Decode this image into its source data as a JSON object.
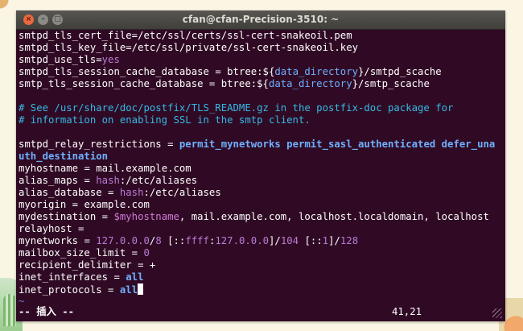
{
  "window": {
    "title": "cfan@cfan-Precision-3510: ~"
  },
  "controls": {
    "close": "×",
    "minimize": "–",
    "maximize": "□"
  },
  "editor": {
    "lines": [
      [
        {
          "t": "smtpd_tls_cert_file",
          "c": "k"
        },
        {
          "t": "=/etc/ssl/certs/ssl-cert-snakeoil.pem",
          "c": "v"
        }
      ],
      [
        {
          "t": "smtpd_tls_key_file",
          "c": "k"
        },
        {
          "t": "=/etc/ssl/private/ssl-cert-snakeoil.key",
          "c": "v"
        }
      ],
      [
        {
          "t": "smtpd_use_tls",
          "c": "k"
        },
        {
          "t": "=",
          "c": "v"
        },
        {
          "t": "yes",
          "c": "pu"
        }
      ],
      [
        {
          "t": "smtpd_tls_session_cache_database",
          "c": "k"
        },
        {
          "t": " = btree:${",
          "c": "v"
        },
        {
          "t": "data_directory",
          "c": "bl"
        },
        {
          "t": "}/smtpd_scache",
          "c": "v"
        }
      ],
      [
        {
          "t": "smtp_tls_session_cache_database",
          "c": "k"
        },
        {
          "t": " = btree:${",
          "c": "v"
        },
        {
          "t": "data_directory",
          "c": "bl"
        },
        {
          "t": "}/smtp_scache",
          "c": "v"
        }
      ],
      [],
      [
        {
          "t": "# See /usr/share/doc/postfix/TLS_README.gz in the postfix-doc package for",
          "c": "cm"
        }
      ],
      [
        {
          "t": "# information on enabling SSL in the smtp client.",
          "c": "cm"
        }
      ],
      [],
      [
        {
          "t": "smtpd_relay_restrictions",
          "c": "k"
        },
        {
          "t": " = ",
          "c": "v"
        },
        {
          "t": "permit_mynetworks permit_sasl_authenticated defer_una",
          "c": "bb"
        }
      ],
      [
        {
          "t": "uth_destination",
          "c": "bb"
        }
      ],
      [
        {
          "t": "myhostname",
          "c": "k"
        },
        {
          "t": " = mail.example.com",
          "c": "v"
        }
      ],
      [
        {
          "t": "alias_maps",
          "c": "k"
        },
        {
          "t": " = ",
          "c": "v"
        },
        {
          "t": "hash",
          "c": "pu"
        },
        {
          "t": ":/etc/aliases",
          "c": "v"
        }
      ],
      [
        {
          "t": "alias_database",
          "c": "k"
        },
        {
          "t": " = ",
          "c": "v"
        },
        {
          "t": "hash",
          "c": "pu"
        },
        {
          "t": ":/etc/aliases",
          "c": "v"
        }
      ],
      [
        {
          "t": "myorigin",
          "c": "k"
        },
        {
          "t": " = example.com",
          "c": "v"
        }
      ],
      [
        {
          "t": "mydestination",
          "c": "k"
        },
        {
          "t": " = ",
          "c": "v"
        },
        {
          "t": "$myhostname",
          "c": "mg"
        },
        {
          "t": ", mail.example.com, localhost.localdomain, localhost",
          "c": "v"
        }
      ],
      [
        {
          "t": "relayhost",
          "c": "k"
        },
        {
          "t": " =",
          "c": "v"
        }
      ],
      [
        {
          "t": "mynetworks",
          "c": "k"
        },
        {
          "t": " = ",
          "c": "v"
        },
        {
          "t": "127.0.0.0",
          "c": "pu"
        },
        {
          "t": "/",
          "c": "v"
        },
        {
          "t": "8",
          "c": "pu"
        },
        {
          "t": " [::",
          "c": "v"
        },
        {
          "t": "ffff",
          "c": "pu"
        },
        {
          "t": ":",
          "c": "v"
        },
        {
          "t": "127.0.0.0",
          "c": "pu"
        },
        {
          "t": "]/",
          "c": "v"
        },
        {
          "t": "104",
          "c": "pu"
        },
        {
          "t": " [::",
          "c": "v"
        },
        {
          "t": "1",
          "c": "pu"
        },
        {
          "t": "]/",
          "c": "v"
        },
        {
          "t": "128",
          "c": "pu"
        }
      ],
      [
        {
          "t": "mailbox_size_limit",
          "c": "k"
        },
        {
          "t": " = ",
          "c": "v"
        },
        {
          "t": "0",
          "c": "pu"
        }
      ],
      [
        {
          "t": "recipient_delimiter",
          "c": "k"
        },
        {
          "t": " = +",
          "c": "v"
        }
      ],
      [
        {
          "t": "inet_interfaces",
          "c": "k"
        },
        {
          "t": " = ",
          "c": "v"
        },
        {
          "t": "all",
          "c": "bb"
        }
      ],
      [
        {
          "t": "inet_protocols",
          "c": "k"
        },
        {
          "t": " = ",
          "c": "v"
        },
        {
          "t": "all",
          "c": "bb"
        },
        {
          "t": "",
          "c": "cursor"
        }
      ],
      [
        {
          "t": "~",
          "c": "tilde"
        }
      ]
    ]
  },
  "status": {
    "mode": "-- 插入 --",
    "position": "41,21"
  }
}
